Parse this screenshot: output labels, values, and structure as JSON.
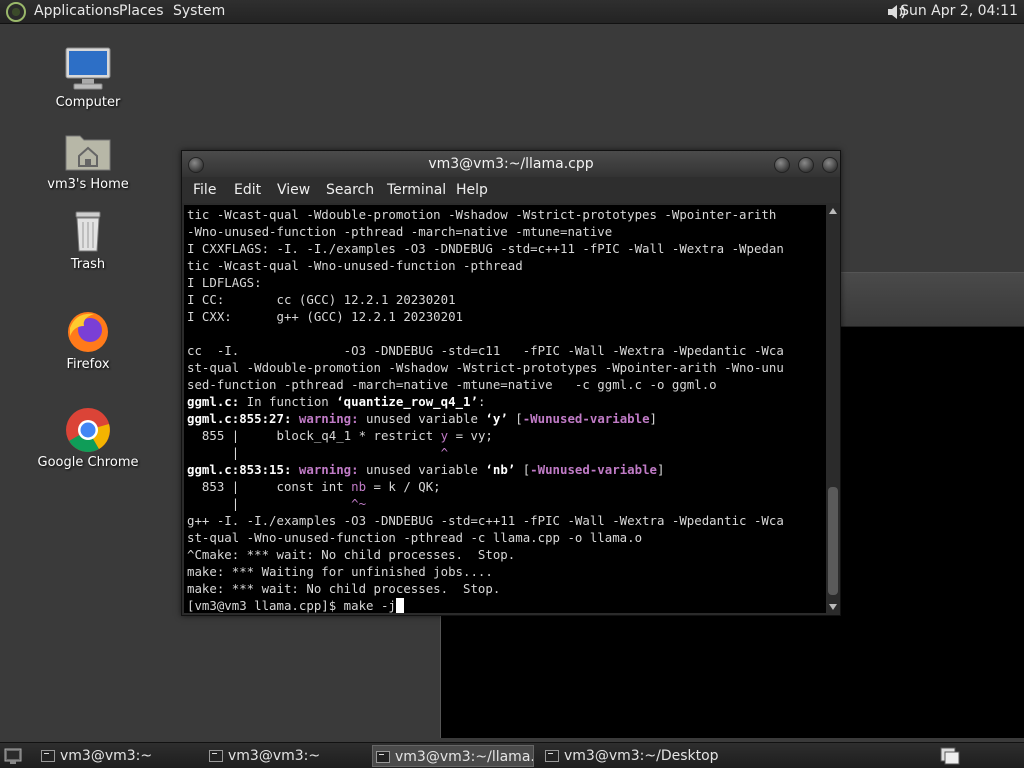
{
  "top_panel": {
    "menus": [
      "Applications",
      "Places",
      "System"
    ],
    "clock": "Sun Apr  2, 04:11"
  },
  "desktop_icons": [
    {
      "label": "Computer",
      "icon": "computer-icon"
    },
    {
      "label": "vm3's Home",
      "icon": "home-folder-icon"
    },
    {
      "label": "Trash",
      "icon": "trash-icon"
    },
    {
      "label": "Firefox",
      "icon": "firefox-icon"
    },
    {
      "label": "Google Chrome",
      "icon": "chrome-icon"
    }
  ],
  "terminal": {
    "title": "vm3@vm3:~/llama.cpp",
    "menu": [
      "File",
      "Edit",
      "View",
      "Search",
      "Terminal",
      "Help"
    ],
    "lines": {
      "l1": "tic -Wcast-qual -Wdouble-promotion -Wshadow -Wstrict-prototypes -Wpointer-arith",
      "l2": "-Wno-unused-function -pthread -march=native -mtune=native",
      "l3": "I CXXFLAGS: -I. -I./examples -O3 -DNDEBUG -std=c++11 -fPIC -Wall -Wextra -Wpedan",
      "l4": "tic -Wcast-qual -Wno-unused-function -pthread",
      "l5": "I LDFLAGS:",
      "l6": "I CC:       cc (GCC) 12.2.1 20230201",
      "l7": "I CXX:      g++ (GCC) 12.2.1 20230201",
      "l8": "",
      "l9": "cc  -I.              -O3 -DNDEBUG -std=c11   -fPIC -Wall -Wextra -Wpedantic -Wca",
      "l10": "st-qual -Wdouble-promotion -Wshadow -Wstrict-prototypes -Wpointer-arith -Wno-unu",
      "l11": "sed-function -pthread -march=native -mtune=native   -c ggml.c -o ggml.o",
      "l12_a": "ggml.c:",
      "l12_b": " In function ",
      "l12_c": "‘quantize_row_q4_1’",
      "l12_d": ":",
      "l13_a": "ggml.c:855:27: ",
      "l13_b": "warning: ",
      "l13_c": "unused variable ",
      "l13_d": "‘y’",
      "l13_e": " [",
      "l13_f": "-Wunused-variable",
      "l13_g": "]",
      "l14_a": "  855 |     block_q4_1 * restrict ",
      "l14_b": "y",
      "l14_c": " = vy;",
      "l15_a": "      |                           ",
      "l15_b": "^",
      "l16_a": "ggml.c:853:15: ",
      "l16_b": "warning: ",
      "l16_c": "unused variable ",
      "l16_d": "‘nb’",
      "l16_e": " [",
      "l16_f": "-Wunused-variable",
      "l16_g": "]",
      "l17_a": "  853 |     const int ",
      "l17_b": "nb",
      "l17_c": " = k / QK;",
      "l18_a": "      |               ",
      "l18_b": "^~",
      "l19": "g++ -I. -I./examples -O3 -DNDEBUG -std=c++11 -fPIC -Wall -Wextra -Wpedantic -Wca",
      "l20": "st-qual -Wno-unused-function -pthread -c llama.cpp -o llama.o",
      "l21": "^Cmake: *** wait: No child processes.  Stop.",
      "l22": "make: *** Waiting for unfinished jobs....",
      "l23": "make: *** wait: No child processes.  Stop.",
      "prompt": "[vm3@vm3 llama.cpp]$ make -j"
    }
  },
  "taskbar": {
    "tasks": [
      "vm3@vm3:~",
      "vm3@vm3:~",
      "vm3@vm3:~/llama....",
      "vm3@vm3:~/Desktop"
    ]
  }
}
